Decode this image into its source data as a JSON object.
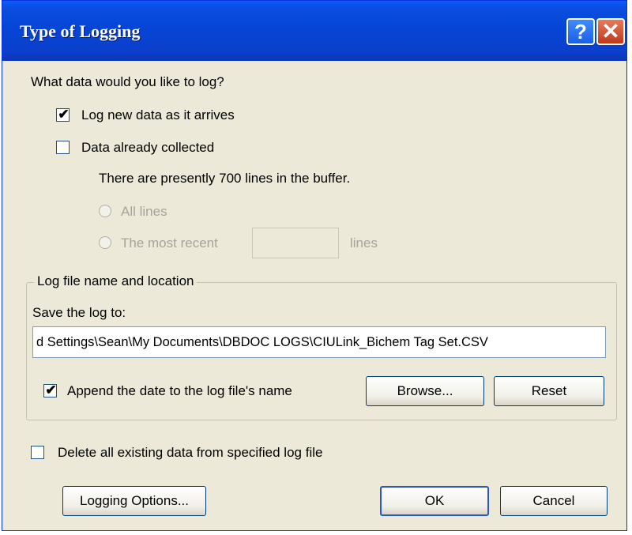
{
  "dialog": {
    "title": "Type of Logging",
    "help_glyph": "?",
    "close_glyph": "✕"
  },
  "question": "What data would you like to log?",
  "log_new": {
    "label": "Log new data as it arrives",
    "checked": true
  },
  "already_collected": {
    "label": "Data already collected",
    "checked": false
  },
  "buffer_info": "There are presently 700 lines in the buffer.",
  "radio_all": {
    "label": "All lines",
    "enabled": false
  },
  "radio_recent": {
    "label": "The most recent",
    "suffix": "lines",
    "value": "",
    "enabled": false
  },
  "log_file": {
    "group_label": "Log file name and location",
    "save_label": "Save the log to:",
    "path": "d Settings\\Sean\\My Documents\\DBDOC LOGS\\CIULink_Bichem Tag Set.CSV",
    "append_date": {
      "label": "Append the date to the log file's name",
      "checked": true
    },
    "browse_label": "Browse...",
    "reset_label": "Reset"
  },
  "delete_existing": {
    "label": "Delete all existing data from specified log file",
    "checked": false
  },
  "buttons": {
    "logging_options": "Logging Options...",
    "ok": "OK",
    "cancel": "Cancel"
  },
  "colors": {
    "title_bar": "#0645d6",
    "face": "#ece9d8",
    "close_button": "#c0391b",
    "disabled_text": "#a6a49a"
  }
}
